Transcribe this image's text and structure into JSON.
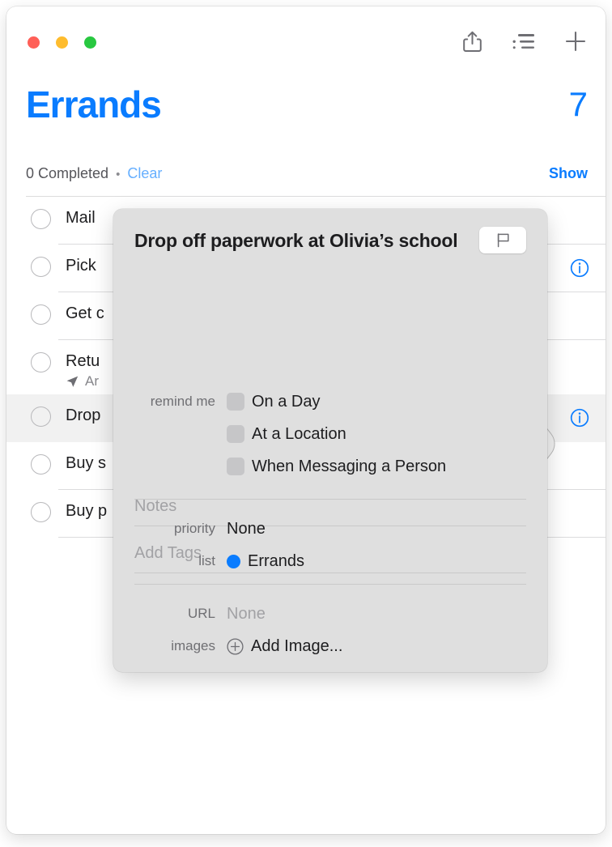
{
  "window": {
    "traffic_lights": [
      {
        "name": "close",
        "color": "#FF5F57"
      },
      {
        "name": "minimize",
        "color": "#FEBC2E"
      },
      {
        "name": "zoom",
        "color": "#28C840"
      }
    ],
    "toolbar": {
      "share_icon": "share-icon",
      "view_options_icon": "list-view-icon",
      "add_icon": "plus-icon"
    }
  },
  "header": {
    "title": "Errands",
    "count": "7",
    "completed_text": "0 Completed",
    "separator_dot": "•",
    "clear_label": "Clear",
    "show_label": "Show",
    "title_color": "#0A7CFF"
  },
  "tasks": [
    {
      "title": "Mail",
      "subtitle": "",
      "selected": false,
      "has_info": false
    },
    {
      "title": "Pick",
      "subtitle": "",
      "selected": false,
      "has_info": true
    },
    {
      "title": "Get c",
      "subtitle": "",
      "selected": false,
      "has_info": false
    },
    {
      "title": "Retu",
      "subtitle": "Ar",
      "location_icon": "location-arrow-icon",
      "selected": false,
      "has_info": false
    },
    {
      "title": "Drop",
      "subtitle": "",
      "selected": true,
      "has_info": true
    },
    {
      "title": "Buy s",
      "subtitle": "",
      "selected": false,
      "has_info": false
    },
    {
      "title": "Buy p",
      "subtitle": "",
      "selected": false,
      "has_info": false
    }
  ],
  "popover": {
    "title": "Drop off paperwork at Olivia’s school",
    "flag_button_icon": "flag-icon",
    "notes_placeholder": "Notes",
    "tags_placeholder": "Add Tags",
    "remind_me": {
      "label": "remind me",
      "options": [
        {
          "label": "On a Day",
          "checked": false
        },
        {
          "label": "At a Location",
          "checked": false
        },
        {
          "label": "When Messaging a Person",
          "checked": false
        }
      ]
    },
    "priority": {
      "label": "priority",
      "value": "None"
    },
    "list": {
      "label": "list",
      "value": "Errands",
      "dot_color": "#0A7CFF"
    },
    "url": {
      "label": "URL",
      "value": "None"
    },
    "images": {
      "label": "images",
      "action_label": "Add Image...",
      "icon": "plus-circle-icon"
    }
  }
}
